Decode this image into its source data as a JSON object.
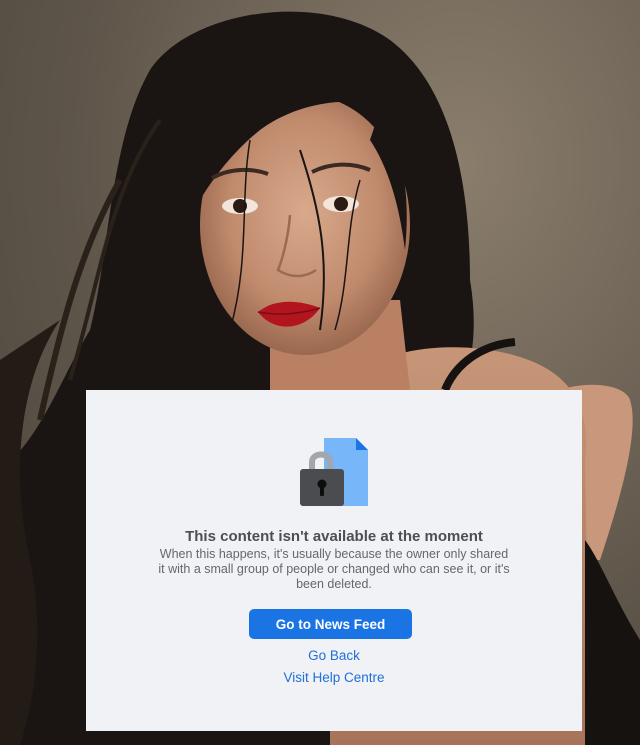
{
  "background": {
    "description_icon": "portrait-photo"
  },
  "notice": {
    "icon": "locked-document-icon",
    "title": "This content isn't available at the moment",
    "message": "When this happens, it's usually because the owner only shared it with a small group of people or changed who can see it, or it's been deleted.",
    "primary_button_label": "Go to News Feed",
    "links": {
      "go_back": "Go Back",
      "help_centre": "Visit Help Centre"
    }
  },
  "colors": {
    "card_background": "#f0f2f5",
    "primary_button": "#1b74e4",
    "link": "#216fdb",
    "title_text": "#4b4f56",
    "body_text": "#65676b"
  }
}
